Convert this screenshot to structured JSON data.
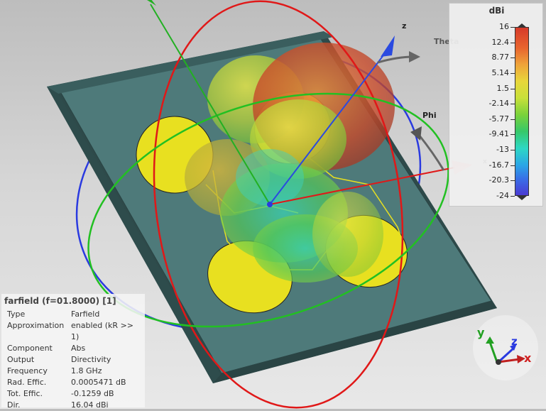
{
  "legend": {
    "unit": "dBi",
    "ticks": [
      "16",
      "12.4",
      "8.77",
      "5.14",
      "1.5",
      "-2.14",
      "-5.77",
      "-9.41",
      "-13",
      "-16.7",
      "-20.3",
      "-24"
    ]
  },
  "info_panel": {
    "title": "farfield (f=01.8000) [1]",
    "rows": [
      {
        "key": "Type",
        "value": "Farfield"
      },
      {
        "key": "Approximation",
        "value": "enabled (kR >> 1)"
      },
      {
        "key": "Component",
        "value": "Abs"
      },
      {
        "key": "Output",
        "value": "Directivity"
      },
      {
        "key": "Frequency",
        "value": "1.8 GHz"
      },
      {
        "key": "Rad. Effic.",
        "value": "0.0005471 dB"
      },
      {
        "key": "Tot. Effic.",
        "value": "-0.1259 dB"
      },
      {
        "key": "Dir.",
        "value": "16.04 dBi"
      }
    ]
  },
  "scene_labels": {
    "z_axis": "z",
    "theta": "Theta",
    "phi": "Phi",
    "x_axis_faint": "x"
  },
  "orientation_triad": {
    "x": "x",
    "y": "y",
    "z": "z"
  },
  "colors": {
    "x_axis": "#e01818",
    "y_axis": "#22b022",
    "z_axis": "#2a4ae0",
    "substrate": "#4e7a7a",
    "patch": "#e8e020"
  }
}
